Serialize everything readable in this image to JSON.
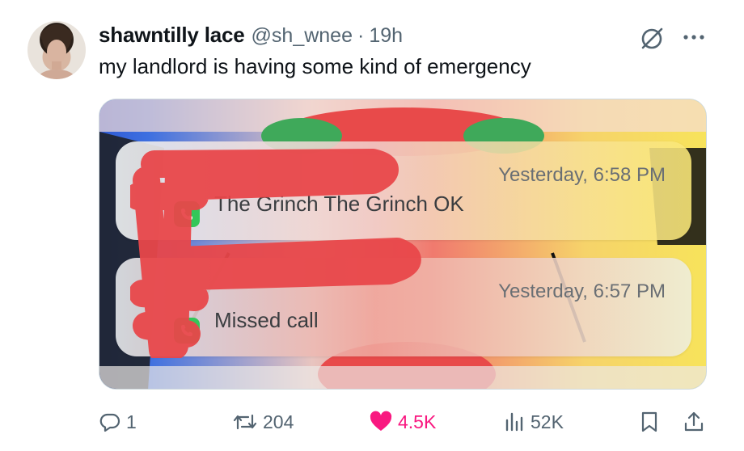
{
  "tweet": {
    "display_name": "shawntilly lace",
    "handle": "@sh_wnee",
    "separator": "·",
    "time": "19h",
    "text": "my landlord is having some kind of emergency"
  },
  "media": {
    "notifications": [
      {
        "timestamp": "Yesterday, 6:58 PM",
        "message": "The Grinch The Grinch OK",
        "icon": "phone-icon"
      },
      {
        "timestamp": "Yesterday, 6:57 PM",
        "message": "Missed call",
        "icon": "phone-icon"
      }
    ],
    "colors": {
      "scribble": "#e8474a",
      "phone_badge": "#34c759"
    }
  },
  "actions": {
    "replies": "1",
    "retweets": "204",
    "likes": "4.5K",
    "views": "52K"
  },
  "icons": [
    "grok-icon",
    "more-icon",
    "reply-icon",
    "retweet-icon",
    "heart-icon",
    "views-icon",
    "bookmark-icon",
    "share-icon"
  ],
  "colors": {
    "like_active": "#f91880",
    "muted": "#536471"
  }
}
